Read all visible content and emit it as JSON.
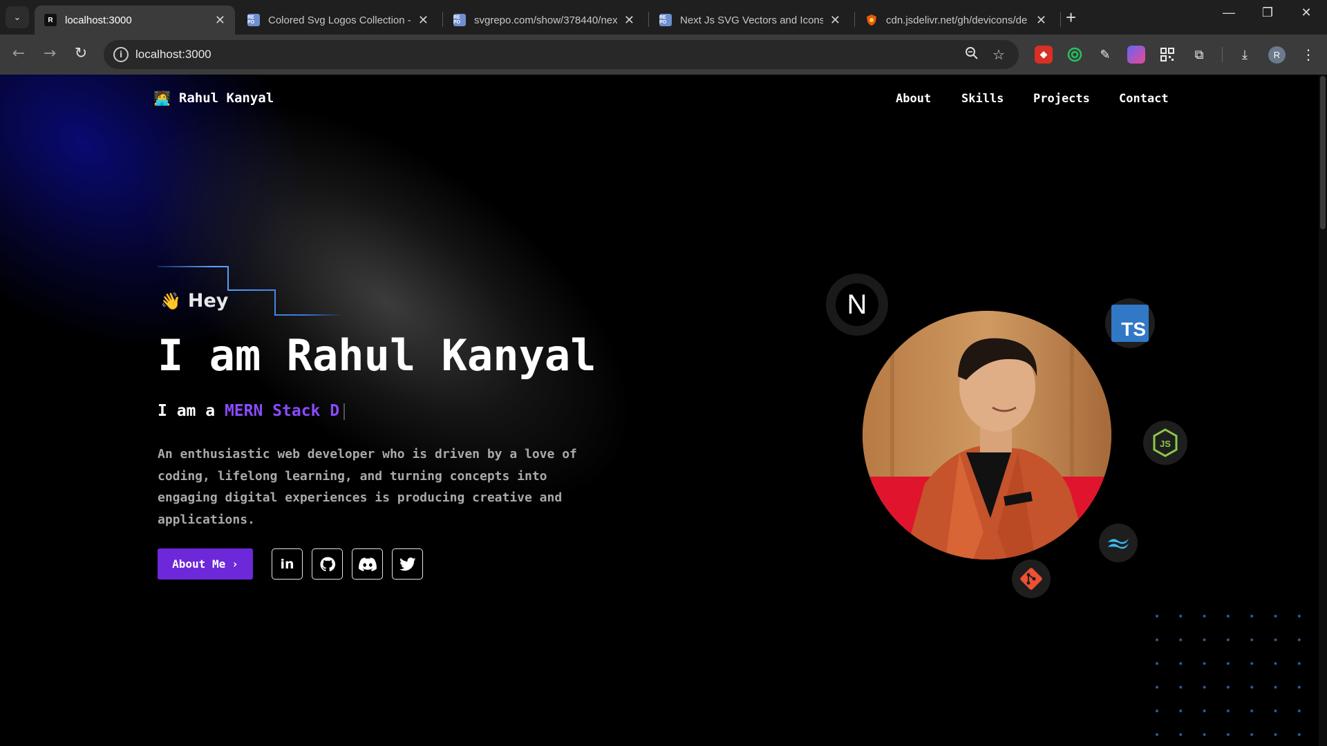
{
  "browser": {
    "tabs": [
      {
        "title": "localhost:3000",
        "favicon": "R",
        "active": true
      },
      {
        "title": "Colored Svg Logos Collection -",
        "favicon": "RE PO"
      },
      {
        "title": "svgrepo.com/show/378440/nex",
        "favicon": "RE PO"
      },
      {
        "title": "Next Js SVG Vectors and Icons -",
        "favicon": "RE PO"
      },
      {
        "title": "cdn.jsdelivr.net/gh/devicons/de",
        "favicon": "shield"
      }
    ],
    "address": "localhost:3000",
    "profile_initial": "R"
  },
  "site": {
    "brand_emoji": "🧑‍💻",
    "brand_name": "Rahul Kanyal",
    "nav": [
      "About",
      "Skills",
      "Projects",
      "Contact"
    ]
  },
  "hero": {
    "greeting_emoji": "👋",
    "greeting": "Hey",
    "headline": "I am Rahul Kanyal",
    "sub_prefix": "I am a ",
    "sub_typed": "MERN Stack D",
    "bio": "An enthusiastic web developer who is driven by a love of coding, lifelong learning, and turning concepts into engaging digital experiences is producing creative and applications.",
    "cta_label": "About Me",
    "socials": [
      "linkedin-icon",
      "github-icon",
      "discord-icon",
      "twitter-icon"
    ],
    "social_li_text": "in"
  },
  "tech_icons": {
    "nextjs": "N",
    "typescript": "TS",
    "nodejs": "JS"
  },
  "colors": {
    "accent_purple": "#6d28d9",
    "typed_text": "#8a4bff",
    "page_bg": "#000000",
    "typescript_blue": "#3178c6",
    "node_green": "#8cc84b",
    "tailwind_cyan": "#38bdf8",
    "git_orange": "#f05032"
  }
}
